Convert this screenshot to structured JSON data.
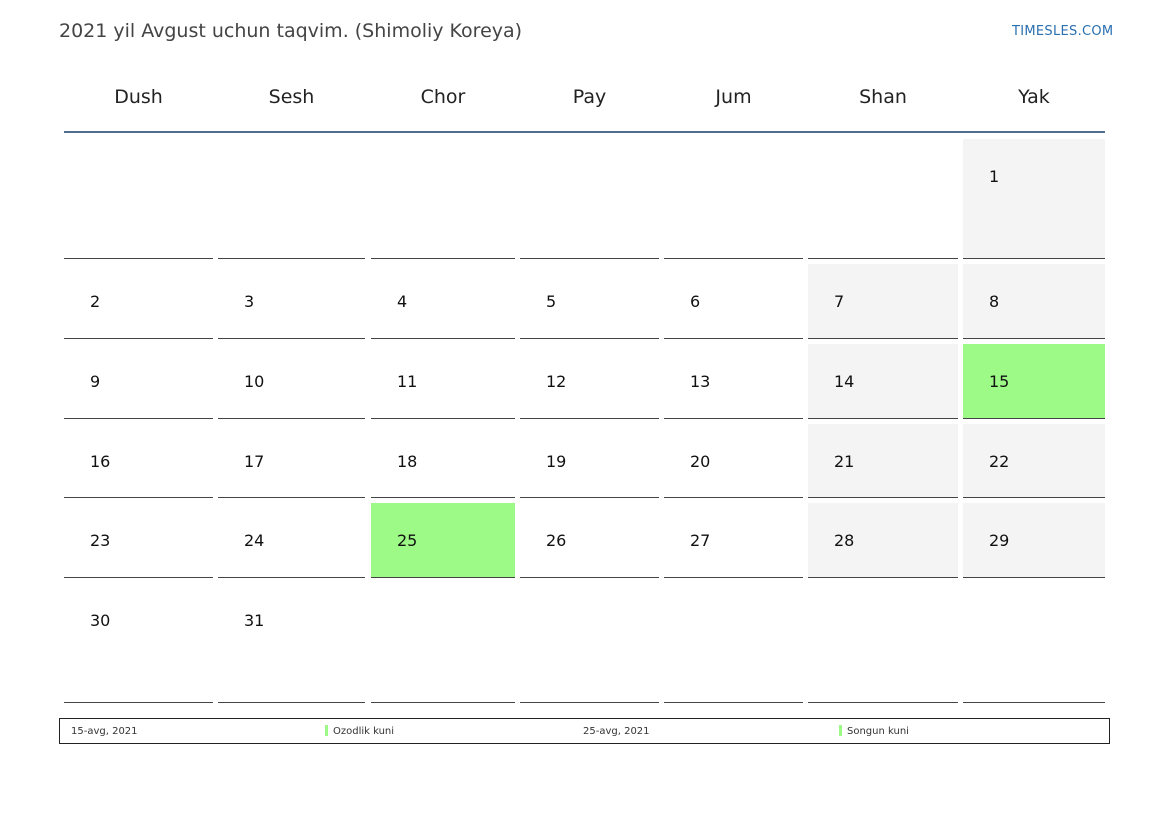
{
  "title": "2021 yil Avgust uchun taqvim. (Shimoliy Koreya)",
  "brand": "TIMESLES.COM",
  "weekdays": [
    "Dush",
    "Sesh",
    "Chor",
    "Pay",
    "Jum",
    "Shan",
    "Yak"
  ],
  "weeks": [
    [
      "",
      "",
      "",
      "",
      "",
      "",
      "1"
    ],
    [
      "2",
      "3",
      "4",
      "5",
      "6",
      "7",
      "8"
    ],
    [
      "9",
      "10",
      "11",
      "12",
      "13",
      "14",
      "15"
    ],
    [
      "16",
      "17",
      "18",
      "19",
      "20",
      "21",
      "22"
    ],
    [
      "23",
      "24",
      "25",
      "26",
      "27",
      "28",
      "29"
    ],
    [
      "30",
      "31",
      "",
      "",
      "",
      "",
      ""
    ]
  ],
  "holidays": [
    "15",
    "25"
  ],
  "colors": {
    "holiday": "#9dfa86",
    "weekend": "#f4f4f4",
    "header_line": "#4f6d8f",
    "brand": "#2a6fb0"
  },
  "legend": [
    {
      "date": "15-avg, 2021",
      "name": "Ozodlik kuni"
    },
    {
      "date": "25-avg, 2021",
      "name": "Songun kuni"
    }
  ]
}
